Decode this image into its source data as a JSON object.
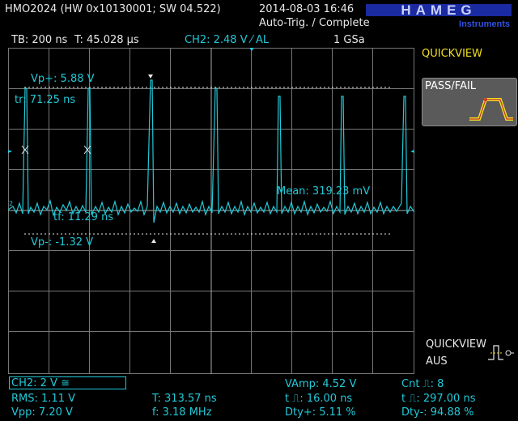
{
  "header": {
    "device": "HMO2024 (HW 0x10130001; SW 04.522)",
    "datetime": "2014-08-03 16:46",
    "trigger_status": "Auto-Trig. / Complete",
    "brand": "HAMEG",
    "brand_sub": "Instruments"
  },
  "status_bar": {
    "timebase": "TB: 200 ns",
    "time_position": "T: 45.028 µs",
    "channel_trigger": "CH2: 2.48 V ⁄ AL",
    "sample_rate": "1 GSa"
  },
  "screen": {
    "vp_plus": "Vp+: 5.88 V",
    "tr": "tr: 71.25 ns",
    "tf": "tf: 11.29 ns",
    "vp_minus": "Vp-: -1.32 V",
    "mean": "Mean: 319.23 mV",
    "trace_color": "#22c9d8"
  },
  "side_menu": {
    "title": "QUICKVIEW",
    "pass_fail_label": "PASS/FAIL",
    "bottom_title": "QUICKVIEW",
    "bottom_sub": "AUS"
  },
  "measurements": {
    "channel_scale": "CH2: 2 V ≅",
    "rms": "RMS: 1.11 V",
    "vpp": "Vpp: 7.20 V",
    "period": "T: 313.57 ns",
    "freq": "f: 3.18 MHz",
    "vamp": "VAmp: 4.52 V",
    "pulse_width_pos": "t ⎍: 16.00 ns",
    "duty_pos": "Dty+: 5.11 %",
    "count": "Cnt ⎍: 8",
    "pulse_width_neg": "t ⎍: 297.00 ns",
    "duty_neg": "Dty-: 94.88 %"
  }
}
